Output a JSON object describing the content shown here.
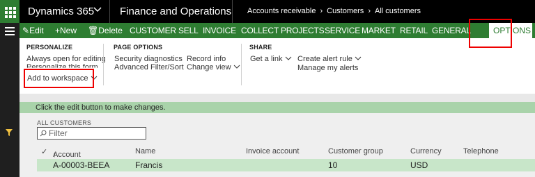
{
  "header": {
    "app_name": "Dynamics 365",
    "module": "Finance and Operations",
    "breadcrumbs": [
      "Accounts receivable",
      "Customers",
      "All customers"
    ]
  },
  "actionbar": {
    "edit": "Edit",
    "new": "New",
    "delete": "Delete",
    "tabs": [
      "CUSTOMER",
      "SELL",
      "INVOICE",
      "COLLECT",
      "PROJECTS",
      "SERVICE",
      "MARKET",
      "RETAIL",
      "GENERAL"
    ],
    "active_tab": "OPTIONS"
  },
  "ribbon": {
    "personalize": {
      "title": "PERSONALIZE",
      "items": [
        "Always open for editing",
        "Personalize this form",
        "Add to workspace"
      ]
    },
    "page_options": {
      "title": "PAGE OPTIONS",
      "items": [
        "Security diagnostics",
        "Advanced Filter/Sort",
        "Record info",
        "Change view"
      ]
    },
    "share": {
      "title": "SHARE",
      "items": [
        "Get a link",
        "Create alert rule",
        "Manage my alerts"
      ]
    }
  },
  "info": {
    "message": "Click the edit button to make changes."
  },
  "grid": {
    "title": "ALL CUSTOMERS",
    "filter_placeholder": "Filter",
    "columns": [
      "Account",
      "Name",
      "Invoice account",
      "Customer group",
      "Currency",
      "Telephone"
    ],
    "sort_indicator": "↑",
    "rows": [
      {
        "account": "A-00003-BEEA",
        "name": "Francis",
        "invoice": "",
        "group": "10",
        "currency": "USD",
        "phone": ""
      }
    ]
  },
  "colors": {
    "brand_green": "#2e7d32",
    "highlight_red": "#e00000",
    "info_green": "#a9d3aa"
  }
}
